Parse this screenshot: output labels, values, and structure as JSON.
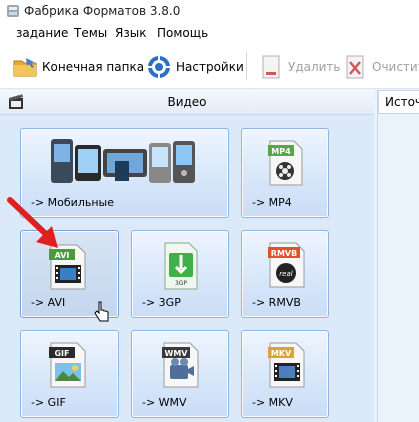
{
  "window": {
    "title": "Фабрика Форматов 3.8.0"
  },
  "menu": [
    "задание",
    "Темы",
    "Язык",
    "Помощь"
  ],
  "toolbar": {
    "output_folder": "Конечная папка",
    "settings": "Настройки",
    "delete": "Удалить",
    "clear": "Очистит"
  },
  "panel": {
    "title": "Видео"
  },
  "right": {
    "source_header": "Источ"
  },
  "tiles": [
    {
      "label": "-> Мобильные",
      "badge": ""
    },
    {
      "label": "-> MP4",
      "badge": "MP4"
    },
    {
      "label": "-> AVI",
      "badge": "AVI"
    },
    {
      "label": "-> 3GP",
      "badge": "3GP"
    },
    {
      "label": "-> RMVB",
      "badge": "RMVB"
    },
    {
      "label": "-> GIF",
      "badge": "GIF"
    },
    {
      "label": "-> WMV",
      "badge": "WMV"
    },
    {
      "label": "-> MKV",
      "badge": "MKV"
    }
  ],
  "colors": {
    "mp4": "#5aa54a",
    "avi": "#4d9a3a",
    "rmvb": "#e0522a",
    "gif": "#2a2a2a",
    "wmv": "#3a3a3a",
    "mkv": "#d8a43a",
    "arrow": "#e02020"
  }
}
